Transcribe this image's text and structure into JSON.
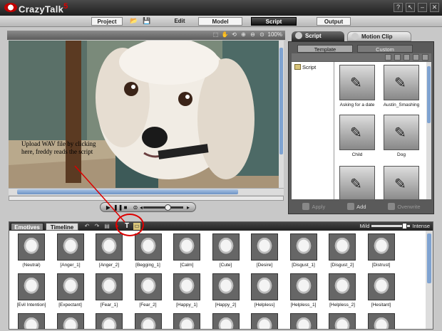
{
  "window": {
    "brand": "CrazyTalk",
    "brand_version": "5",
    "controls": [
      "?",
      "↖",
      "–",
      "✕"
    ]
  },
  "menu": {
    "project": "Project",
    "edit": "Edit",
    "model": "Model",
    "script": "Script",
    "output": "Output"
  },
  "viewport": {
    "zoom": "100%",
    "annotation": "Upload WAV file by clicking here, freddy reads the script",
    "photo": "dog-photo"
  },
  "right_panel": {
    "tabs": {
      "script": "Script",
      "motion_clip": "Motion Clip"
    },
    "subtabs": {
      "template": "Template",
      "custom": "Custom"
    },
    "tree_item": "Script",
    "templates": [
      "Asking for a date",
      "Austin_Smashing",
      "Child",
      "Dog",
      "",
      ""
    ],
    "footer": {
      "apply": "Apply",
      "add": "Add",
      "overwrite": "Overwrite"
    }
  },
  "emotives": {
    "tabs": {
      "emotives": "Emotives",
      "timeline": "Timeline"
    },
    "intensity": {
      "mild": "Mild",
      "intense": "Intense",
      "level": 0.9
    },
    "row1": [
      "(Neutral)",
      "[Anger_1]",
      "[Anger_2]",
      "[Begging_1]",
      "[Calm]",
      "[Cute]",
      "[Desire]",
      "[Disgust_1]",
      "[Disgust_2]",
      "[Distrust]"
    ],
    "row2": [
      "[Evil Intention]",
      "[Expectant]",
      "[Fear_1]",
      "[Fear_2]",
      "[Happy_1]",
      "[Happy_2]",
      "[Helpless]",
      "[Helpless_1]",
      "[Helpless_2]",
      "[Hesitant]"
    ]
  },
  "colors": {
    "accent_red": "#d00000",
    "panel_dark": "#5a5a5a",
    "scroll_blue": "#7fa3d1"
  }
}
